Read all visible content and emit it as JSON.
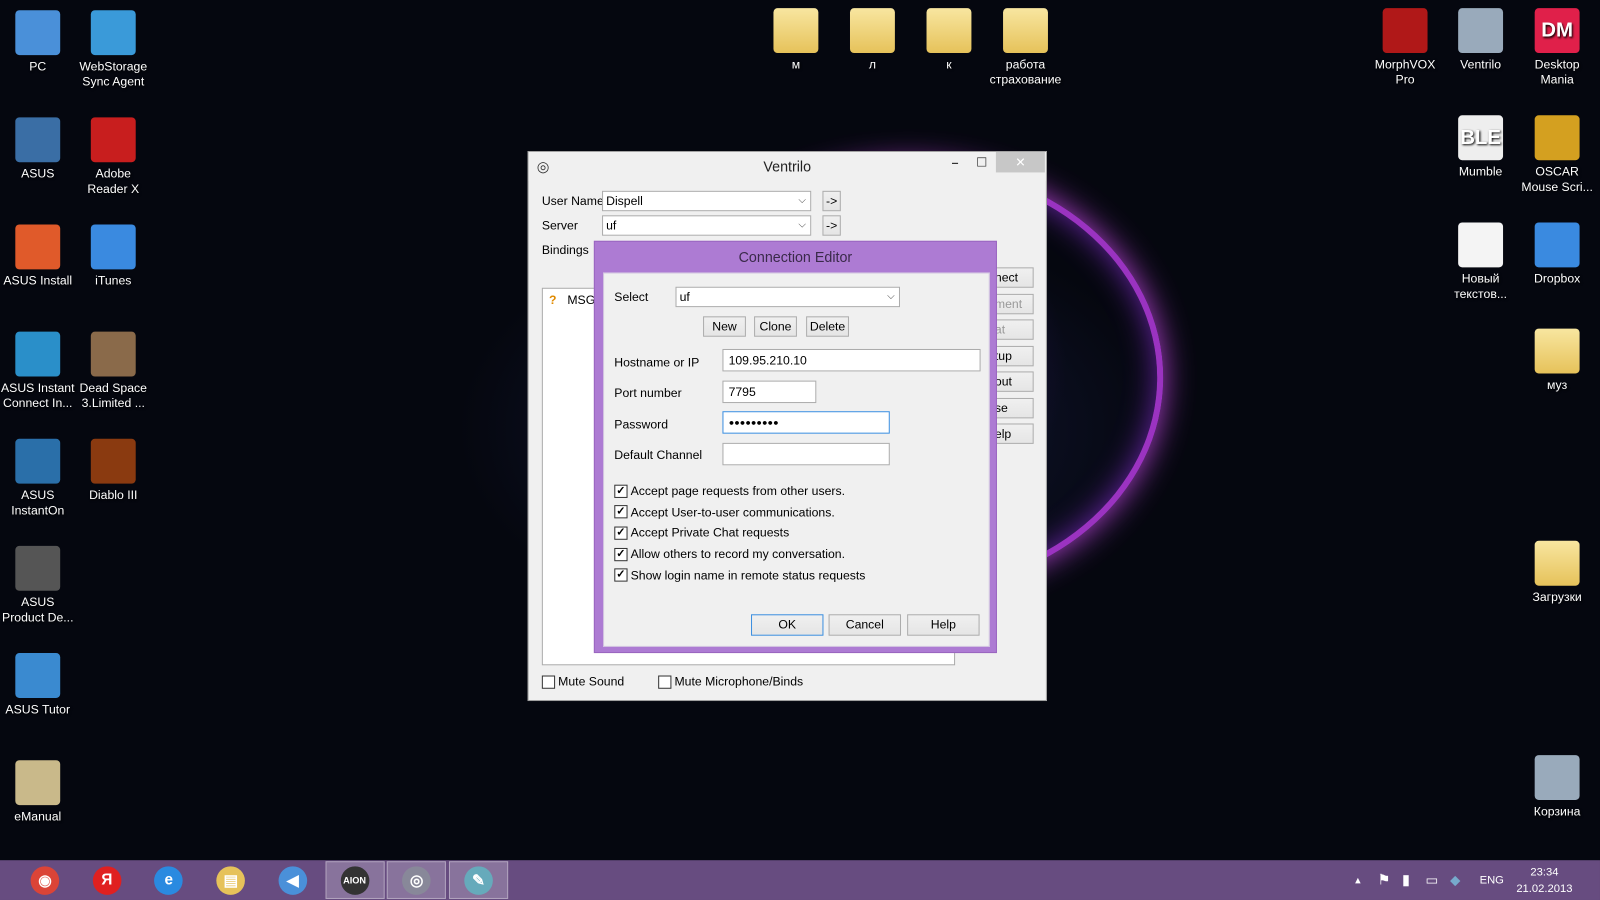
{
  "desktop": {
    "left_icons": [
      {
        "label": "PC",
        "color": "#4a90d9"
      },
      {
        "label": "ASUS",
        "color": "#3a6ea5"
      },
      {
        "label": "ASUS Install",
        "color": "#e05a2a"
      },
      {
        "label": "ASUS Instant Connect In...",
        "color": "#2a8fc9"
      },
      {
        "label": "ASUS InstantOn",
        "color": "#2a6fa9"
      },
      {
        "label": "ASUS Product De...",
        "color": "#555"
      },
      {
        "label": "ASUS Tutor",
        "color": "#3a8ad0"
      },
      {
        "label": "eManual",
        "color": "#c9b98a"
      }
    ],
    "second_icons": [
      {
        "label": "WebStorage Sync Agent",
        "color": "#3a9ad9"
      },
      {
        "label": "Adobe Reader X",
        "color": "#c81e1e"
      },
      {
        "label": "iTunes",
        "color": "#3a8ae0"
      },
      {
        "label": "Dead Space 3.Limited ...",
        "color": "#8a6a4a"
      },
      {
        "label": "Diablo III",
        "color": "#8a3a10"
      }
    ],
    "top_folders": [
      "м",
      "л",
      "к",
      "работа страхование"
    ],
    "right_icons": [
      {
        "label": "MorphVOX Pro",
        "color": "#b01818"
      },
      {
        "label": "Ventrilo",
        "color": "#9ab"
      },
      {
        "label": "Desktop Mania",
        "color": "#e0204a",
        "glyph": "DM"
      },
      {
        "label": "Mumble",
        "color": "#eee",
        "glyph": "BLE"
      },
      {
        "label": "OSCAR Mouse Scri...",
        "color": "#d4a020"
      },
      {
        "label": "Новый текстов...",
        "color": "#f4f4f4"
      },
      {
        "label": "Dropbox",
        "color": "#3a8ae0"
      },
      {
        "label": "муз",
        "color": "#e6c25a"
      },
      {
        "label": "Загрузки",
        "color": "#e6c25a"
      },
      {
        "label": "Корзина",
        "color": "#9ab"
      }
    ]
  },
  "ventrilo": {
    "title": "Ventrilo",
    "user_name_label": "User Name",
    "user_name": "Dispell",
    "server_label": "Server",
    "server": "uf",
    "bindings_label": "Bindings",
    "arrow_label": "->",
    "msg_text": "MSG:",
    "side_buttons": [
      {
        "label": "nect",
        "enabled": true
      },
      {
        "label": "ment",
        "enabled": false
      },
      {
        "label": "at",
        "enabled": false
      },
      {
        "label": "tup",
        "enabled": true
      },
      {
        "label": "out",
        "enabled": true
      },
      {
        "label": "se",
        "enabled": true
      },
      {
        "label": "elp",
        "enabled": true
      }
    ],
    "mute_sound": {
      "label": "Mute Sound",
      "checked": false
    },
    "mute_mic": {
      "label": "Mute Microphone/Binds",
      "checked": false
    }
  },
  "connection_editor": {
    "title": "Connection Editor",
    "select_label": "Select",
    "select_value": "uf",
    "new": "New",
    "clone": "Clone",
    "delete": "Delete",
    "hostname_label": "Hostname or IP",
    "hostname": "109.95.210.10",
    "port_label": "Port number",
    "port": "7795",
    "password_label": "Password",
    "password_mask": "●●●●●●●●●",
    "channel_label": "Default Channel",
    "channel": "",
    "options": [
      {
        "label": "Accept page requests from other users.",
        "checked": true
      },
      {
        "label": "Accept User-to-user communications.",
        "checked": true
      },
      {
        "label": "Accept Private Chat requests",
        "checked": true
      },
      {
        "label": "Allow others to record my conversation.",
        "checked": true
      },
      {
        "label": "Show login name in remote status requests",
        "checked": true
      }
    ],
    "ok": "OK",
    "cancel": "Cancel",
    "help": "Help",
    "accent": "#ad7bd3"
  },
  "taskbar": {
    "apps": [
      {
        "name": "chrome",
        "glyph": "◉",
        "color": "#db4437",
        "active": false
      },
      {
        "name": "yandex",
        "glyph": "Я",
        "color": "#e02020",
        "active": false
      },
      {
        "name": "internet-explorer",
        "glyph": "e",
        "color": "#2a8ae0",
        "active": false
      },
      {
        "name": "file-explorer",
        "glyph": "▤",
        "color": "#e6c25a",
        "active": false
      },
      {
        "name": "sound",
        "glyph": "◀",
        "color": "#4a90d9",
        "active": false
      },
      {
        "name": "aion",
        "glyph": "AION",
        "color": "#333",
        "active": true
      },
      {
        "name": "ventrilo",
        "glyph": "◎",
        "color": "#889",
        "active": true
      },
      {
        "name": "paint",
        "glyph": "✎",
        "color": "#6ab",
        "active": true
      }
    ],
    "language": "ENG",
    "time": "23:34",
    "date": "21.02.2013",
    "color": "#674c80"
  }
}
